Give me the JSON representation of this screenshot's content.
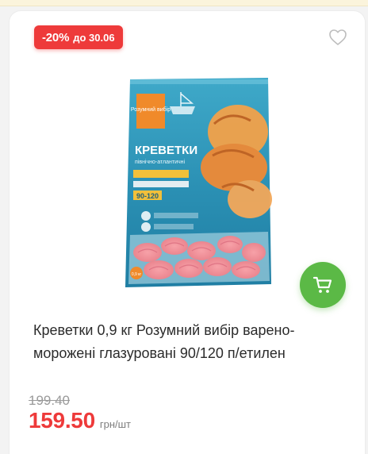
{
  "badge": {
    "percent": "-20%",
    "until": "до 30.06",
    "color": "#ee3a3a"
  },
  "favorite_icon": "heart-outline-icon",
  "image": {
    "brand": "Розумний вибір",
    "name": "КРЕВЕТКИ",
    "subname": "північно-атлантичні",
    "size": "90-120",
    "weight_mark": "0,9 кг"
  },
  "cart_icon": "cart-icon",
  "product": {
    "title": "Креветки 0,9 кг Розумний вибір варено-мороженi глазуровані 90/120 п/етилен",
    "old_price": "199.40",
    "price": "159.50",
    "unit": "грн/шт"
  },
  "colors": {
    "accent_green": "#5bb946",
    "price_red": "#ee3a3a"
  }
}
